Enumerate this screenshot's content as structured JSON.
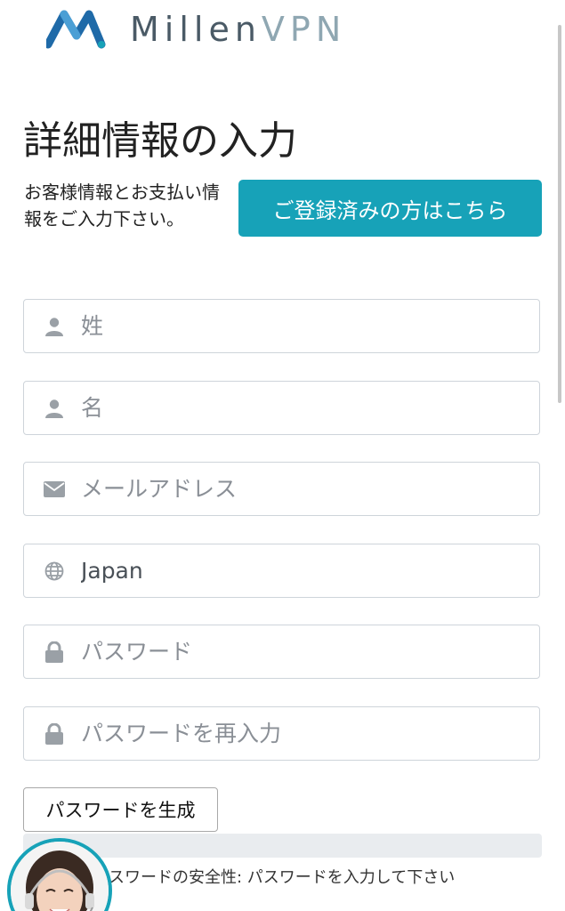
{
  "header": {
    "logo_text_main": "Millen",
    "logo_text_accent": "VPN",
    "brand_colors": {
      "primary": "#1f6aa8",
      "accent": "#17a2b8",
      "text": "#4a5a66",
      "text_light": "#8fa7b2"
    }
  },
  "page": {
    "title": "詳細情報の入力",
    "intro": "お客様情報とお支払い情報をご入力下さい。",
    "login_button": "ご登録済みの方はこちら"
  },
  "form": {
    "fields": [
      {
        "name": "last-name",
        "icon": "user-icon",
        "placeholder": "姓",
        "value": ""
      },
      {
        "name": "first-name",
        "icon": "user-icon",
        "placeholder": "名",
        "value": ""
      },
      {
        "name": "email",
        "icon": "envelope-icon",
        "placeholder": "メールアドレス",
        "value": ""
      },
      {
        "name": "country",
        "icon": "globe-icon",
        "placeholder": "",
        "value": "Japan"
      },
      {
        "name": "password",
        "icon": "lock-icon",
        "placeholder": "パスワード",
        "value": ""
      },
      {
        "name": "password-confirm",
        "icon": "lock-icon",
        "placeholder": "パスワードを再入力",
        "value": ""
      }
    ],
    "generate_button": "パスワードを生成",
    "strength_text": "スワードの安全性: パスワードを入力して下さい",
    "strength_level": 0
  },
  "support": {
    "avatar_icon": "support-agent-avatar"
  }
}
